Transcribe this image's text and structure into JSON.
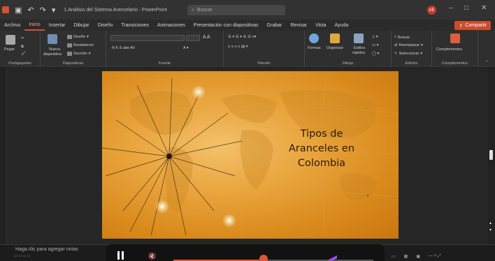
{
  "titlebar": {
    "document_title": "1.Análisis del Sistema Arancelario  -  PowerPoint",
    "search_placeholder": "Buscar",
    "user_initials": "AE",
    "qa_undo": "↶",
    "qa_redo": "↷",
    "minimize": "–",
    "restore": "□",
    "close": "✕"
  },
  "tabs": [
    "Archivo",
    "Inicio",
    "Insertar",
    "Dibujar",
    "Diseño",
    "Transiciones",
    "Animaciones",
    "Presentación con diapositivas",
    "Grabar",
    "Revisar",
    "Vista",
    "Ayuda"
  ],
  "active_tab": "Inicio",
  "share_label": "Compartir",
  "ribbon": {
    "groups": {
      "clipboard": "Portapapeles",
      "slides": "Diapositivas",
      "font": "Fuente",
      "paragraph": "Párrafo",
      "drawing": "Dibujo",
      "editing": "Edición",
      "addins": "Complementos"
    },
    "paste": "Pegar",
    "new_slide_line1": "Nueva",
    "new_slide_line2": "diapositiva",
    "layout": "Diseño",
    "reset": "Restablecer",
    "section": "Sección",
    "font_format": "N  K  S  abe  AV",
    "shapes": "Formas",
    "arrange": "Organizar",
    "quick_styles_line1": "Estilos",
    "quick_styles_line2": "rápidos",
    "find": "Buscar",
    "replace": "Reemplazar",
    "select": "Seleccionar",
    "addins": "Complementos"
  },
  "slide": {
    "title_lines": [
      "Tipos de",
      "Aranceles en",
      "Colombia"
    ]
  },
  "notes_placeholder": "Haga clic para agregar notas",
  "media": {
    "progress": 0.45
  },
  "colors": {
    "accent": "#d35230",
    "share": "#c94d2b",
    "media_progress": "#e0543a"
  }
}
